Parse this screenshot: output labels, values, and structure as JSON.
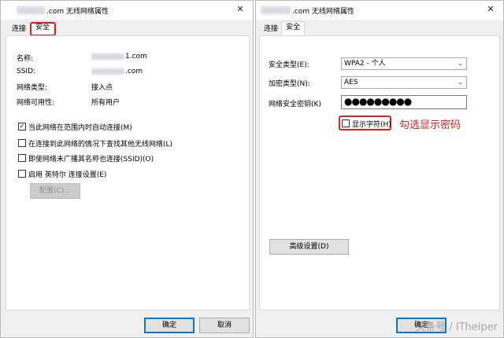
{
  "left_window": {
    "title": ".com 无线网络属性",
    "tabs": [
      {
        "label": "连接",
        "active": false
      },
      {
        "label": "安全",
        "active": true
      }
    ],
    "info": [
      {
        "label": "名称:",
        "value": "1.com"
      },
      {
        "label": "SSID:",
        "value": ".com"
      },
      {
        "label": "网络类型:",
        "value": "接入点"
      },
      {
        "label": "网络可用性:",
        "value": "所有用户"
      }
    ],
    "checkboxes": [
      {
        "label": "当此网络在范围内时自动连接(M)",
        "checked": true
      },
      {
        "label": "在连接到此网络的情况下查找其他无线网络(L)",
        "checked": false
      },
      {
        "label": "即使网络未广播其名称也连接(SSID)(O)",
        "checked": false
      },
      {
        "label": "启用 英特尔 连接设置(E)",
        "checked": false
      }
    ],
    "configure_label": "配置(C)...",
    "ok_label": "确定",
    "cancel_label": "取消"
  },
  "right_window": {
    "title": ".com 无线网络属性",
    "tabs": [
      {
        "label": "连接",
        "active": false
      },
      {
        "label": "安全",
        "active": true
      }
    ],
    "security_type_label": "安全类型(E):",
    "security_type_value": "WPA2 - 个人",
    "encryption_type_label": "加密类型(N):",
    "encryption_type_value": "AES",
    "key_label": "网络安全密钥(K)",
    "key_value": "●●●●●●●●●",
    "show_chars_label": "显示字符(H)",
    "show_chars_checked": false,
    "annotation": "勾选显示密码",
    "advanced_label": "高级设置(D)",
    "ok_label": "确定"
  },
  "watermark": "头条号 / ITheiper",
  "colors": {
    "highlight": "#e02020",
    "accent": "#0078d7"
  }
}
